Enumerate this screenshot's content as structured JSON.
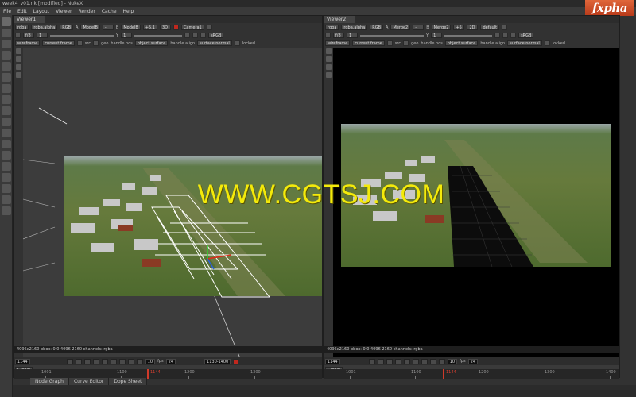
{
  "window": {
    "title": "week4_v01.nk [modified] - NukeX"
  },
  "logo": {
    "text": "fxpha"
  },
  "menu": [
    "File",
    "Edit",
    "Layout",
    "Viewer",
    "Render",
    "Cache",
    "Help"
  ],
  "viewer1": {
    "tab": "Viewer1",
    "row1": {
      "channels": "rgba",
      "layer": "rgba.alpha",
      "mode": "RGB",
      "a_label": "A",
      "a_input": "ModelB",
      "dash": "-",
      "b_label": "B",
      "b_input": "ModelB",
      "gain": "+5.1",
      "view": "3D",
      "camera": "Camera1"
    },
    "row2": {
      "fstop": "f/8",
      "gain_val": "1",
      "y_label": "Y",
      "y_val": "1",
      "colorspace": "sRGB"
    },
    "row3": {
      "render": "wireframe",
      "frame": "current frame",
      "src": "src",
      "geo": "geo",
      "handle_pos_label": "handle pos",
      "handle_pos": "object surface",
      "handle_align_label": "handle align",
      "handle_align": "surface normal",
      "locked": "locked"
    },
    "info": "4096x2160 bbox: 0 0 4096 2160 channels: rgba",
    "timeline": {
      "frame": "1144",
      "fps_label": "fps",
      "fps": "24",
      "step": "10",
      "range": "1130-1400",
      "scope": "Global",
      "ticks": [
        "1001",
        "1100",
        "1200",
        "1300"
      ],
      "marker": "1144"
    }
  },
  "viewer2": {
    "tab": "Viewer2",
    "row1": {
      "channels": "rgba",
      "layer": "rgba.alpha",
      "mode": "RGB",
      "a_label": "A",
      "a_input": "Merge2",
      "dash": "-",
      "b_label": "B",
      "b_input": "Merge2",
      "gain": "+5",
      "view": "2D",
      "lut": "default"
    },
    "row2": {
      "fstop": "f/8",
      "gain_val": "1",
      "y_label": "Y",
      "y_val": "1",
      "colorspace": "sRGB"
    },
    "row3": {
      "render": "wireframe",
      "frame": "current frame",
      "src": "src",
      "geo": "geo",
      "handle_pos_label": "handle pos",
      "handle_pos": "object surface",
      "handle_align_label": "handle align",
      "handle_align": "surface normal",
      "locked": "locked"
    },
    "info": "4096x2160 bbox: 0 0 4096 2160 channels: rgba",
    "timeline": {
      "frame": "1144",
      "fps_label": "fps",
      "fps": "24",
      "step": "10",
      "scope": "Global",
      "ticks": [
        "1001",
        "1100",
        "1200",
        "1300",
        "1400"
      ],
      "marker": "1144"
    }
  },
  "bottom_tabs": [
    "Node Graph",
    "Curve Editor",
    "Dope Sheet"
  ],
  "watermark": "WWW.CGTSJ.COM",
  "colors": {
    "accent_red": "#c0281e",
    "watermark_yellow": "#f4ea0a",
    "overlay_white": "#ffffff"
  },
  "icons": [
    "node-graph-icon",
    "brush-icon",
    "transform-icon",
    "viewer-icon",
    "merge-icon",
    "3d-icon",
    "color-icon",
    "filter-icon"
  ]
}
